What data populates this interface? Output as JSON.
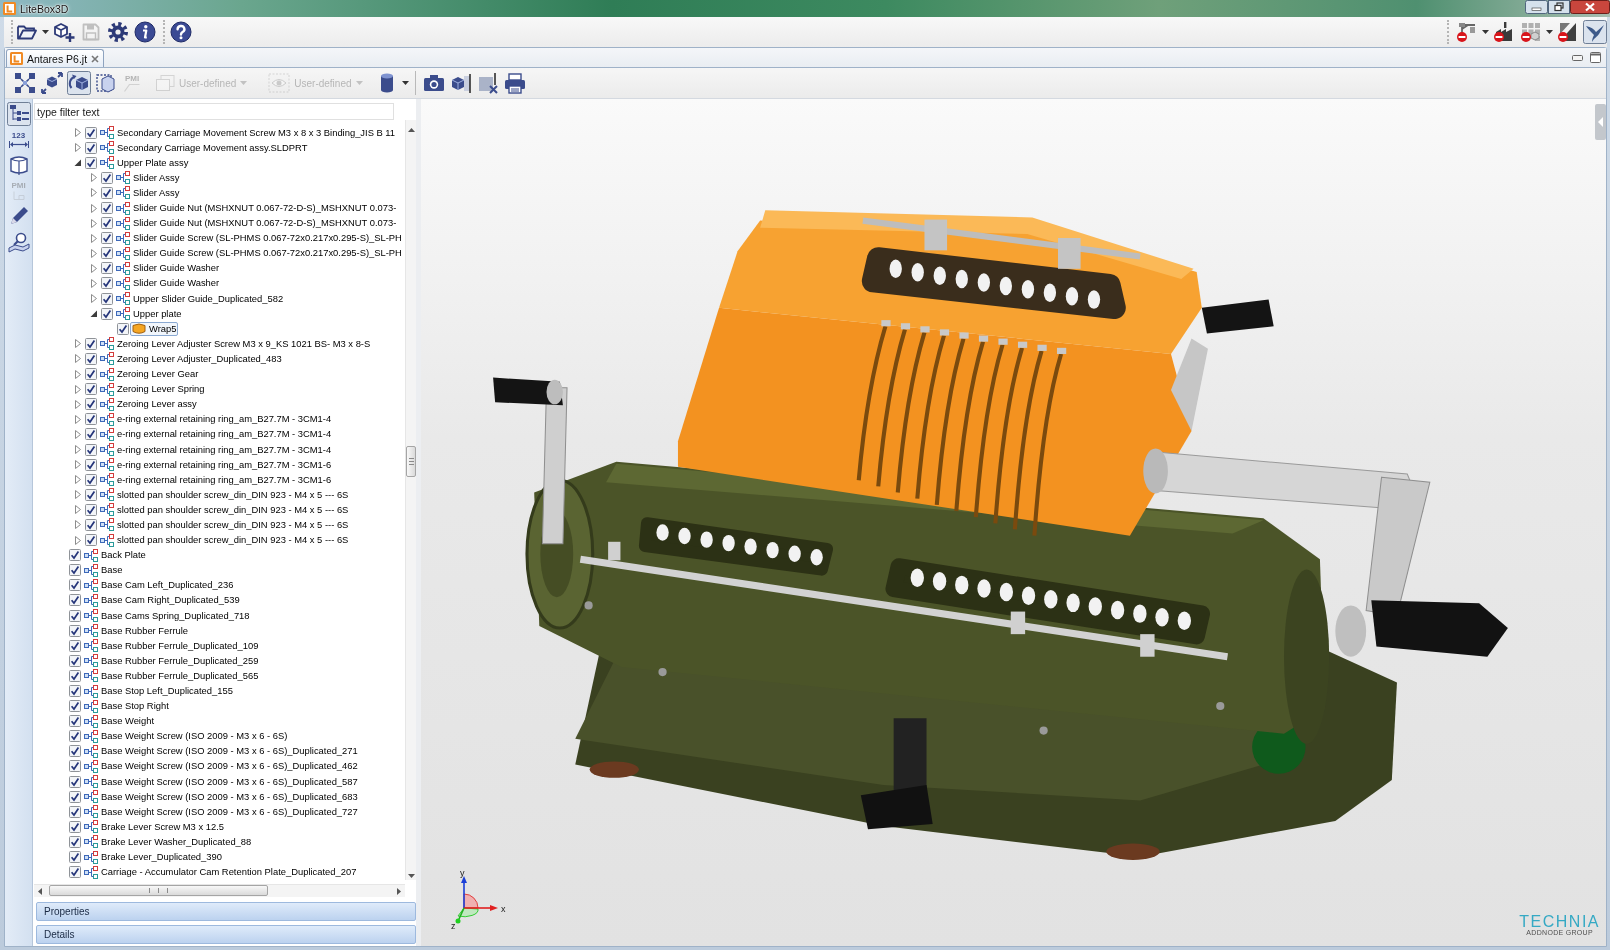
{
  "window": {
    "title": "LiteBox3D"
  },
  "main_toolbar": {
    "left": [
      [
        {
          "dropdown": true,
          "disabled": false,
          "pressed": false
        },
        {
          "dropdown": false,
          "disabled": false,
          "pressed": false
        },
        {
          "dropdown": false,
          "disabled": true,
          "pressed": false
        },
        {
          "dropdown": false,
          "disabled": false,
          "pressed": false
        },
        {
          "dropdown": false,
          "disabled": false,
          "pressed": false
        }
      ],
      [
        {
          "dropdown": false,
          "disabled": false,
          "pressed": false
        }
      ]
    ],
    "right": [
      [
        {
          "dropdown": true,
          "disabled": false,
          "pressed": false
        },
        {
          "dropdown": false,
          "disabled": false,
          "pressed": false
        },
        {
          "dropdown": true,
          "disabled": false,
          "pressed": false
        },
        {
          "dropdown": false,
          "disabled": false,
          "pressed": false
        },
        {
          "dropdown": false,
          "disabled": false,
          "pressed": true
        }
      ]
    ]
  },
  "tabs": [
    {
      "label": "Antares P6.jt",
      "selected": true
    }
  ],
  "view_toolbar": {
    "groups": [
      [
        {
          "dropdown": false,
          "disabled": false,
          "pressed": false
        },
        {
          "dropdown": false,
          "disabled": false,
          "pressed": false
        },
        {
          "dropdown": false,
          "disabled": false,
          "pressed": true
        },
        {
          "dropdown": false,
          "disabled": false,
          "pressed": false
        },
        {
          "label": "PMI",
          "dropdown": false,
          "disabled": true,
          "pressed": false
        },
        {
          "label": "User-defined",
          "dropdown": true,
          "disabled": true,
          "pressed": false
        },
        {
          "label": "User-defined",
          "dropdown": true,
          "disabled": true,
          "pressed": false
        },
        {
          "dropdown": true,
          "disabled": false,
          "pressed": false
        }
      ],
      [
        {
          "dropdown": false,
          "disabled": false,
          "pressed": false
        },
        {
          "dropdown": false,
          "disabled": false,
          "pressed": false
        },
        {
          "dropdown": false,
          "disabled": false,
          "pressed": false
        },
        {
          "dropdown": false,
          "disabled": false,
          "pressed": false
        }
      ]
    ]
  },
  "side_toolbar": {
    "items": [
      {
        "selected": true,
        "disabled": false
      },
      {
        "label": "123",
        "selected": false,
        "disabled": false
      },
      {
        "selected": false,
        "disabled": false
      },
      {
        "label": "PMI",
        "selected": false,
        "disabled": true
      },
      {
        "selected": false,
        "disabled": false
      },
      {
        "selected": false,
        "disabled": false
      }
    ]
  },
  "model_tree": {
    "filter": {
      "placeholder": "type filter text"
    },
    "branch_tail": [
      {
        "label": "Secondary Carriage Movement Screw M3 x 8 x 3 Binding_JIS B 11",
        "kind": "assembly",
        "expanded": false,
        "checked": true,
        "selected": false
      },
      {
        "label": "Secondary Carriage Movement assy.SLDPRT",
        "kind": "assembly",
        "expanded": false,
        "checked": true,
        "selected": false
      },
      {
        "label": "Upper Plate assy",
        "kind": "assembly",
        "expanded": true,
        "checked": true,
        "selected": false,
        "children": [
          {
            "label": "Slider Assy",
            "kind": "assembly",
            "expanded": false,
            "checked": true,
            "selected": false
          },
          {
            "label": "Slider Assy",
            "kind": "assembly",
            "expanded": false,
            "checked": true,
            "selected": false
          },
          {
            "label": "Slider Guide Nut (MSHXNUT 0.067-72-D-S)_MSHXNUT 0.073-",
            "kind": "assembly",
            "expanded": false,
            "checked": true,
            "selected": false
          },
          {
            "label": "Slider Guide Nut (MSHXNUT 0.067-72-D-S)_MSHXNUT 0.073-",
            "kind": "assembly",
            "expanded": false,
            "checked": true,
            "selected": false
          },
          {
            "label": "Slider Guide Screw (SL-PHMS 0.067-72x0.217x0.295-S)_SL-PH",
            "kind": "assembly",
            "expanded": false,
            "checked": true,
            "selected": false
          },
          {
            "label": "Slider Guide Screw (SL-PHMS 0.067-72x0.217x0.295-S)_SL-PH",
            "kind": "assembly",
            "expanded": false,
            "checked": true,
            "selected": false
          },
          {
            "label": "Slider Guide Washer",
            "kind": "assembly",
            "expanded": false,
            "checked": true,
            "selected": false
          },
          {
            "label": "Slider Guide Washer",
            "kind": "assembly",
            "expanded": false,
            "checked": true,
            "selected": false
          },
          {
            "label": "Upper Slider Guide_Duplicated_582",
            "kind": "assembly",
            "expanded": false,
            "checked": true,
            "selected": false
          },
          {
            "label": "Upper plate",
            "kind": "assembly",
            "expanded": true,
            "checked": true,
            "selected": false,
            "children": [
              {
                "label": "Wrap5",
                "kind": "part",
                "checked": true,
                "selected": true
              }
            ]
          }
        ]
      },
      {
        "label": "Zeroing Lever Adjuster Screw M3 x 9_KS 1021 BS- M3 x 8-S",
        "kind": "assembly",
        "expanded": false,
        "checked": true,
        "selected": false
      },
      {
        "label": "Zeroing Lever Adjuster_Duplicated_483",
        "kind": "assembly",
        "expanded": false,
        "checked": true,
        "selected": false
      },
      {
        "label": "Zeroing Lever Gear",
        "kind": "assembly",
        "expanded": false,
        "checked": true,
        "selected": false
      },
      {
        "label": "Zeroing Lever Spring",
        "kind": "assembly",
        "expanded": false,
        "checked": true,
        "selected": false
      },
      {
        "label": "Zeroing Lever assy",
        "kind": "assembly",
        "expanded": false,
        "checked": true,
        "selected": false
      },
      {
        "label": "e-ring external retaining ring_am_B27.7M - 3CM1-4",
        "kind": "assembly",
        "expanded": false,
        "checked": true,
        "selected": false
      },
      {
        "label": "e-ring external retaining ring_am_B27.7M - 3CM1-4",
        "kind": "assembly",
        "expanded": false,
        "checked": true,
        "selected": false
      },
      {
        "label": "e-ring external retaining ring_am_B27.7M - 3CM1-4",
        "kind": "assembly",
        "expanded": false,
        "checked": true,
        "selected": false
      },
      {
        "label": "e-ring external retaining ring_am_B27.7M - 3CM1-6",
        "kind": "assembly",
        "expanded": false,
        "checked": true,
        "selected": false
      },
      {
        "label": "e-ring external retaining ring_am_B27.7M - 3CM1-6",
        "kind": "assembly",
        "expanded": false,
        "checked": true,
        "selected": false
      },
      {
        "label": "slotted pan shoulder screw_din_DIN 923 - M4 x 5 --- 6S",
        "kind": "assembly",
        "expanded": false,
        "checked": true,
        "selected": false
      },
      {
        "label": "slotted pan shoulder screw_din_DIN 923 - M4 x 5 --- 6S",
        "kind": "assembly",
        "expanded": false,
        "checked": true,
        "selected": false
      },
      {
        "label": "slotted pan shoulder screw_din_DIN 923 - M4 x 5 --- 6S",
        "kind": "assembly",
        "expanded": false,
        "checked": true,
        "selected": false
      },
      {
        "label": "slotted pan shoulder screw_din_DIN 923 - M4 x 5 --- 6S",
        "kind": "assembly",
        "expanded": false,
        "checked": true,
        "selected": false
      }
    ],
    "items": [
      {
        "label": "Back Plate",
        "kind": "assembly",
        "checked": true,
        "selected": false
      },
      {
        "label": "Base",
        "kind": "assembly",
        "checked": true,
        "selected": false
      },
      {
        "label": "Base Cam Left_Duplicated_236",
        "kind": "assembly",
        "checked": true,
        "selected": false
      },
      {
        "label": "Base Cam Right_Duplicated_539",
        "kind": "assembly",
        "checked": true,
        "selected": false
      },
      {
        "label": "Base Cams Spring_Duplicated_718",
        "kind": "assembly",
        "checked": true,
        "selected": false
      },
      {
        "label": "Base Rubber Ferrule",
        "kind": "assembly",
        "checked": true,
        "selected": false
      },
      {
        "label": "Base Rubber Ferrule_Duplicated_109",
        "kind": "assembly",
        "checked": true,
        "selected": false
      },
      {
        "label": "Base Rubber Ferrule_Duplicated_259",
        "kind": "assembly",
        "checked": true,
        "selected": false
      },
      {
        "label": "Base Rubber Ferrule_Duplicated_565",
        "kind": "assembly",
        "checked": true,
        "selected": false
      },
      {
        "label": "Base Stop Left_Duplicated_155",
        "kind": "assembly",
        "checked": true,
        "selected": false
      },
      {
        "label": "Base Stop Right",
        "kind": "assembly",
        "checked": true,
        "selected": false
      },
      {
        "label": "Base Weight",
        "kind": "assembly",
        "checked": true,
        "selected": false
      },
      {
        "label": "Base Weight Screw (ISO 2009 - M3 x 6 - 6S)",
        "kind": "assembly",
        "checked": true,
        "selected": false
      },
      {
        "label": "Base Weight Screw (ISO 2009 - M3 x 6 - 6S)_Duplicated_271",
        "kind": "assembly",
        "checked": true,
        "selected": false
      },
      {
        "label": "Base Weight Screw (ISO 2009 - M3 x 6 - 6S)_Duplicated_462",
        "kind": "assembly",
        "checked": true,
        "selected": false
      },
      {
        "label": "Base Weight Screw (ISO 2009 - M3 x 6 - 6S)_Duplicated_587",
        "kind": "assembly",
        "checked": true,
        "selected": false
      },
      {
        "label": "Base Weight Screw (ISO 2009 - M3 x 6 - 6S)_Duplicated_683",
        "kind": "assembly",
        "checked": true,
        "selected": false
      },
      {
        "label": "Base Weight Screw (ISO 2009 - M3 x 6 - 6S)_Duplicated_727",
        "kind": "assembly",
        "checked": true,
        "selected": false
      },
      {
        "label": "Brake Lever Screw M3 x 12.5",
        "kind": "assembly",
        "checked": true,
        "selected": false
      },
      {
        "label": "Brake Lever Washer_Duplicated_88",
        "kind": "assembly",
        "checked": true,
        "selected": false
      },
      {
        "label": "Brake Lever_Duplicated_390",
        "kind": "assembly",
        "checked": true,
        "selected": false
      },
      {
        "label": "Carriage - Accumulator Cam Retention Plate_Duplicated_207",
        "kind": "assembly",
        "checked": true,
        "selected": false
      }
    ]
  },
  "sections": [
    {
      "label": "Properties"
    },
    {
      "label": "Details"
    }
  ],
  "viewport": {
    "axes": [
      {
        "label": "y"
      },
      {
        "label": "x"
      },
      {
        "label": "z"
      }
    ],
    "logo": {
      "name": "TECHNIA",
      "tagline": "ADDNODE GROUP"
    }
  }
}
